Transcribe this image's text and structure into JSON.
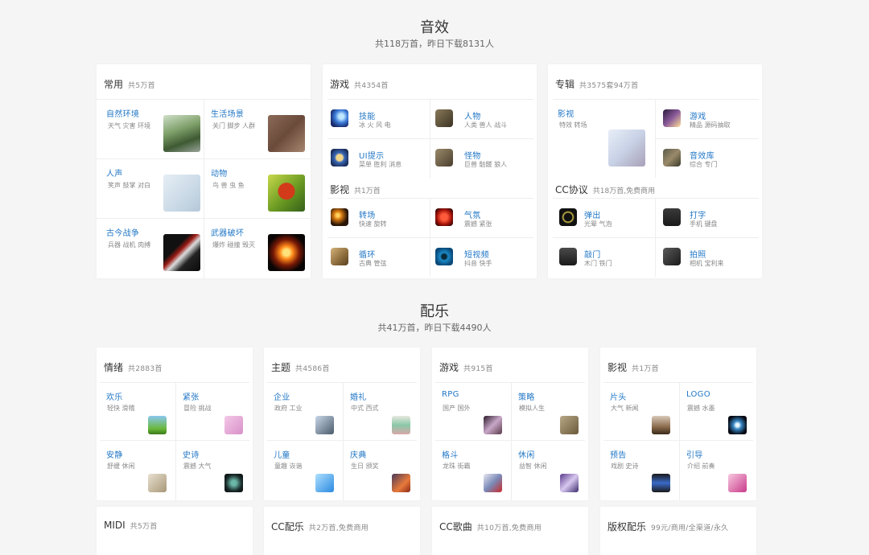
{
  "sfx": {
    "title": "音效",
    "subtitle": "共118万首，昨日下载8131人",
    "changyong": {
      "name": "常用",
      "count": "共5万首",
      "items": [
        {
          "title": "自然环境",
          "tags": "天气 灾害 环境"
        },
        {
          "title": "生活场景",
          "tags": "关门 脚步 人群"
        },
        {
          "title": "人声",
          "tags": "笑声 鼓掌 对白"
        },
        {
          "title": "动物",
          "tags": "鸟 兽 虫 鱼"
        },
        {
          "title": "古今战争",
          "tags": "兵器 战机 肉搏"
        },
        {
          "title": "武器破坏",
          "tags": "爆炸 碰撞 毁灭"
        }
      ]
    },
    "youxi": {
      "name": "游戏",
      "count": "共4354首",
      "items": [
        {
          "title": "技能",
          "tags": "冰 火 风 电"
        },
        {
          "title": "人物",
          "tags": "人类 兽人 战斗"
        },
        {
          "title": "UI提示",
          "tags": "菜单 胜利 消息"
        },
        {
          "title": "怪物",
          "tags": "巨兽 骷髅 狼人"
        }
      ]
    },
    "yingshi": {
      "name": "影视",
      "count": "共1万首",
      "items": [
        {
          "title": "转场",
          "tags": "快速 旋转"
        },
        {
          "title": "气氛",
          "tags": "震撼 紧张"
        },
        {
          "title": "循环",
          "tags": "古典 管弦"
        },
        {
          "title": "短视频",
          "tags": "抖音 快手"
        }
      ]
    },
    "zhuanji": {
      "name": "专辑",
      "count": "共3575套94万首",
      "items": [
        {
          "title": "影视",
          "tags": "特效 转场"
        },
        {
          "title": "游戏",
          "tags": "精品 源码抽取"
        },
        {
          "title": "音效库",
          "tags": "综合 专门"
        }
      ]
    },
    "cc": {
      "name": "CC协议",
      "count": "共18万首,免费商用",
      "items": [
        {
          "title": "弹出",
          "tags": "光晕 气泡"
        },
        {
          "title": "打字",
          "tags": "手机 键盘"
        },
        {
          "title": "敲门",
          "tags": "木门 铁门"
        },
        {
          "title": "拍照",
          "tags": "相机 宝利来"
        }
      ]
    }
  },
  "music": {
    "title": "配乐",
    "subtitle": "共41万首，昨日下载4490人",
    "cards": [
      {
        "name": "情绪",
        "count": "共2883首",
        "items": [
          {
            "title": "欢乐",
            "tags": "轻快 滑稽"
          },
          {
            "title": "紧张",
            "tags": "冒险 挑战"
          },
          {
            "title": "安静",
            "tags": "舒缓 休闲"
          },
          {
            "title": "史诗",
            "tags": "震撼 大气"
          }
        ]
      },
      {
        "name": "主题",
        "count": "共4586首",
        "items": [
          {
            "title": "企业",
            "tags": "政府 工业"
          },
          {
            "title": "婚礼",
            "tags": "中式 西式"
          },
          {
            "title": "儿童",
            "tags": "童趣 诙谐"
          },
          {
            "title": "庆典",
            "tags": "生日 颁奖"
          }
        ]
      },
      {
        "name": "游戏",
        "count": "共915首",
        "items": [
          {
            "title": "RPG",
            "tags": "国产 国外"
          },
          {
            "title": "策略",
            "tags": "模拟人生"
          },
          {
            "title": "格斗",
            "tags": "龙珠 街霸"
          },
          {
            "title": "休闲",
            "tags": "益智 休闲"
          }
        ]
      },
      {
        "name": "影视",
        "count": "共1万首",
        "items": [
          {
            "title": "片头",
            "tags": "大气 新闻"
          },
          {
            "title": "LOGO",
            "tags": "震撼 水墨"
          },
          {
            "title": "预告",
            "tags": "戏剧 史诗"
          },
          {
            "title": "引导",
            "tags": "介绍 前奏"
          }
        ]
      }
    ],
    "bottom": [
      {
        "name": "MIDI",
        "count": "共5万首"
      },
      {
        "name": "CC配乐",
        "count": "共2万首,免费商用"
      },
      {
        "name": "CC歌曲",
        "count": "共10万首,免费商用"
      },
      {
        "name": "版权配乐",
        "count": "99元/商用/全渠道/永久"
      }
    ]
  }
}
